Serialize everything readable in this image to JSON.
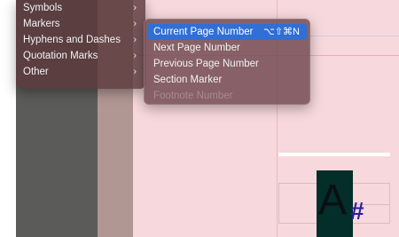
{
  "left_menu": {
    "items": [
      {
        "label": "Symbols",
        "arrow": "›"
      },
      {
        "label": "Markers",
        "arrow": "›"
      },
      {
        "label": "Hyphens and Dashes",
        "arrow": "›"
      },
      {
        "label": "Quotation Marks",
        "arrow": "›"
      },
      {
        "label": "Other",
        "arrow": "›"
      }
    ]
  },
  "submenu": {
    "items": [
      {
        "label": "Current Page Number",
        "shortcut": "⌥⇧⌘N",
        "state": "highlighted"
      },
      {
        "label": "Next Page Number",
        "state": "enabled"
      },
      {
        "label": "Previous Page Number",
        "state": "enabled"
      },
      {
        "label": "Section Marker",
        "state": "enabled"
      },
      {
        "label": "Footnote Number",
        "state": "disabled"
      }
    ]
  },
  "canvas": {
    "frame_glyph": "A",
    "frame_symbol": "#"
  },
  "colors": {
    "highlight": "#2f6fd6",
    "pasteboard": "#f7d8dc",
    "text_frame": "#032e29",
    "hash_color": "#2b1f9c"
  }
}
